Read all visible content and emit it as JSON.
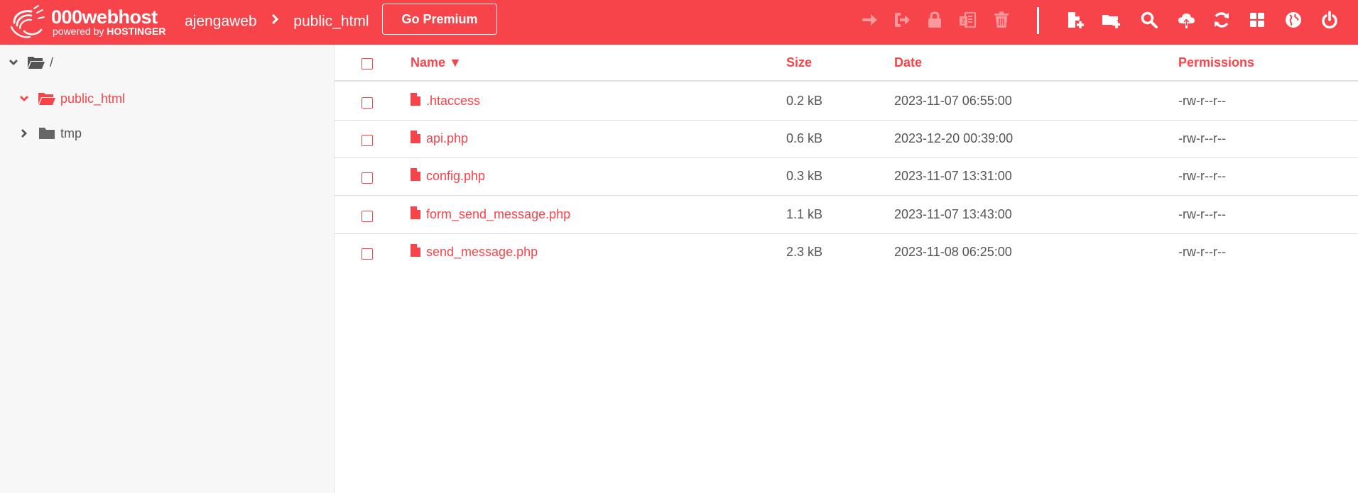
{
  "brand": {
    "name": "000webhost",
    "powered_by": "powered by",
    "company": "HOSTINGER"
  },
  "breadcrumb": {
    "site": "ajengaweb",
    "folder": "public_html"
  },
  "premium_button": "Go Premium",
  "toolbar": {
    "disabled_actions": [
      "arrow-right-icon",
      "sign-out-icon",
      "lock-icon",
      "compress-icon",
      "trash-icon"
    ],
    "actions": [
      "file-add-icon",
      "folder-add-icon",
      "search-icon",
      "upload-cloud-icon",
      "refresh-icon",
      "grid-icon",
      "globe-icon",
      "power-icon"
    ]
  },
  "tree": {
    "root": "/",
    "items": [
      {
        "label": "public_html",
        "expanded": true,
        "active": true
      },
      {
        "label": "tmp",
        "expanded": false,
        "active": false
      }
    ]
  },
  "table": {
    "headers": {
      "name": "Name",
      "sort_indicator": "▼",
      "size": "Size",
      "date": "Date",
      "permissions": "Permissions"
    },
    "rows": [
      {
        "name": ".htaccess",
        "size": "0.2 kB",
        "date": "2023-11-07 06:55:00",
        "permissions": "-rw-r--r--"
      },
      {
        "name": "api.php",
        "size": "0.6 kB",
        "date": "2023-12-20 00:39:00",
        "permissions": "-rw-r--r--"
      },
      {
        "name": "config.php",
        "size": "0.3 kB",
        "date": "2023-11-07 13:31:00",
        "permissions": "-rw-r--r--"
      },
      {
        "name": "form_send_message.php",
        "size": "1.1 kB",
        "date": "2023-11-07 13:43:00",
        "permissions": "-rw-r--r--"
      },
      {
        "name": "send_message.php",
        "size": "2.3 kB",
        "date": "2023-11-08 06:25:00",
        "permissions": "-rw-r--r--"
      }
    ]
  },
  "colors": {
    "accent": "#f7444a",
    "sidebar_bg": "#f7f7f7",
    "text": "#555555"
  }
}
